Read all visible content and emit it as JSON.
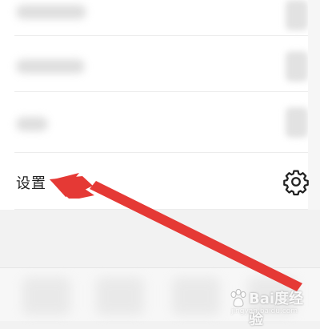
{
  "settings_row": {
    "label": "设置",
    "icon": "gear-icon"
  },
  "annotation": {
    "arrow_color": "#e53935",
    "points_to": "settings_row"
  },
  "watermark": {
    "text": "Bai度经验",
    "url": "jingyan.baidu.com"
  },
  "colors": {
    "page_bg": "#f2f2f2",
    "card_bg": "#ffffff",
    "text": "#222222",
    "arrow": "#e53935"
  }
}
